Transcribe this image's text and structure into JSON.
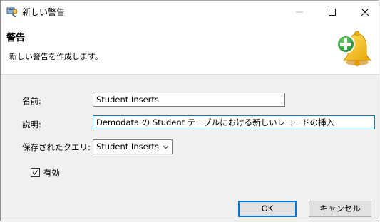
{
  "window": {
    "title": "新しい警告",
    "icon": "alert-dialog-app-icon",
    "caption_buttons": [
      "minimize-icon",
      "maximize-icon",
      "close-icon"
    ]
  },
  "banner": {
    "title": "警告",
    "description": "新しい警告を作成します。",
    "icon": "bell-with-plus-icon"
  },
  "form": {
    "name_label": "名前:",
    "name_value": "Student Inserts",
    "description_label": "説明:",
    "description_value": "Demodata の Student テーブルにおける新しいレコードの挿入",
    "query_label": "保存されたクエリ:",
    "query_selected": "Student Inserts",
    "enabled_label": "有効",
    "enabled_checked": true
  },
  "buttons": {
    "ok": "OK",
    "cancel": "キャンセル"
  },
  "colors": {
    "focus_border": "#0078d7",
    "bell_yellow": "#f5b800",
    "plus_green": "#2e9e3e"
  }
}
